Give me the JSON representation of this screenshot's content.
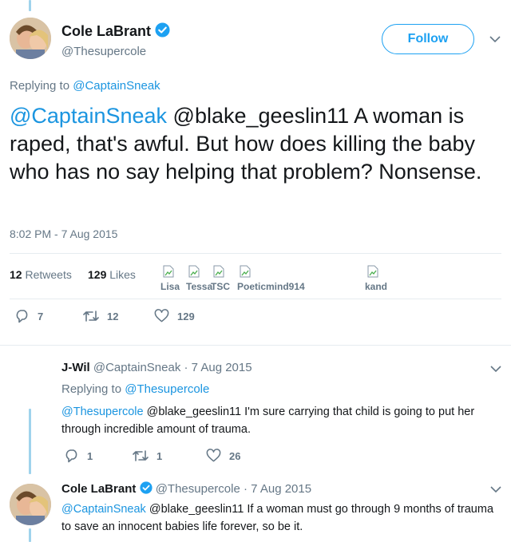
{
  "main_tweet": {
    "author_name": "Cole LaBrant",
    "author_handle": "@Thesupercole",
    "follow_label": "Follow",
    "replying_prefix": "Replying to",
    "replying_to": "@CaptainSneak",
    "mention_1": "@CaptainSneak",
    "mention_2": "@blake_geeslin11",
    "text": "A woman is raped, that's awful. But how does killing the baby who has no say helping that problem? Nonsense.",
    "timestamp": "8:02 PM - 7 Aug 2015",
    "retweet_count": "12",
    "retweet_label": "Retweets",
    "like_count": "129",
    "like_label": "Likes",
    "likers": [
      "Lisa",
      "Tessa",
      "TSC",
      "Poeticmind914",
      "kand"
    ],
    "actions": {
      "reply": "7",
      "retweet": "12",
      "like": "129"
    }
  },
  "reply_1": {
    "author_name": "J-Wil",
    "author_handle": "@CaptainSneak",
    "date": "· 7 Aug 2015",
    "replying_prefix": "Replying to",
    "replying_to": "@Thesupercole",
    "mention_1": "@Thesupercole",
    "text": "@blake_geeslin11 I'm sure carrying that child is going to put her through incredible amount of trauma.",
    "actions": {
      "reply": "1",
      "retweet": "1",
      "like": "26"
    }
  },
  "reply_2": {
    "author_name": "Cole LaBrant",
    "author_handle": "@Thesupercole",
    "date": "· 7 Aug 2015",
    "mention_1": "@CaptainSneak",
    "text": "@blake_geeslin11 If a woman must go through 9 months of trauma to save an innocent babies life forever, so be it."
  },
  "colors": {
    "accent": "#1da1f2",
    "link": "#1b95e0",
    "muted": "#657786",
    "thread": "#9fd3ec",
    "like": "#e0245e"
  },
  "icons": [
    "verified-badge-icon",
    "chevron-down-icon",
    "reply-icon",
    "retweet-icon",
    "heart-icon",
    "broken-image-icon"
  ]
}
